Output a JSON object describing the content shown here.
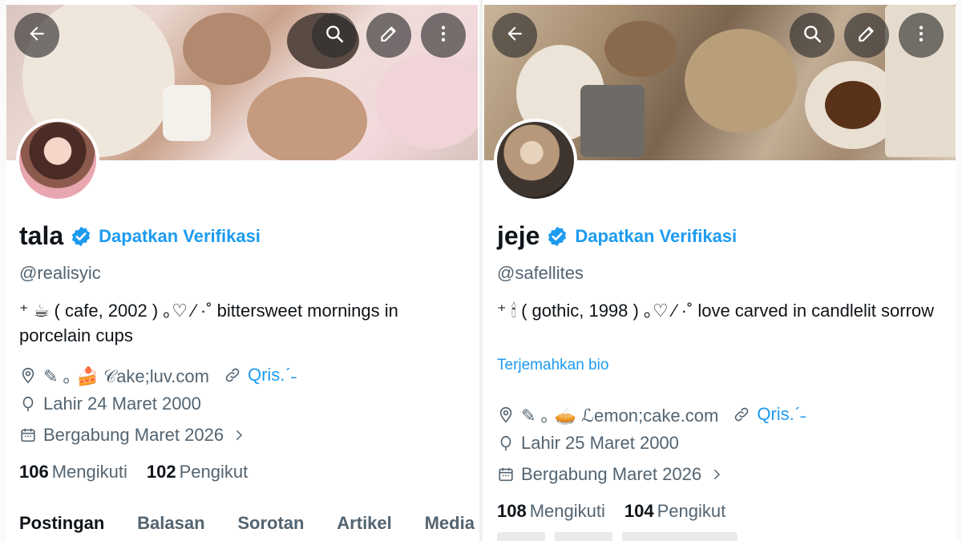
{
  "colors": {
    "accent": "#1d9bf0",
    "text_primary": "#0f1419",
    "text_secondary": "#536471"
  },
  "left": {
    "name": "tala",
    "verify_label": "Dapatkan Verifikasi",
    "handle": "@realisyic",
    "bio": "⁺ ☕ ( cafe, 2002 ) ｡♡ ⁄ ·˚ bittersweet mornings in porcelain cups",
    "location": "✎ ｡ 🍰 𝒞ake;luv.com",
    "link": "Qris.ˊ˗",
    "birthday": "Lahir 24 Maret 2000",
    "joined": "Bergabung Maret 2026",
    "following_count": "106",
    "following_label": "Mengikuti",
    "followers_count": "102",
    "followers_label": "Pengikut",
    "tabs": [
      "Postingan",
      "Balasan",
      "Sorotan",
      "Artikel",
      "Media"
    ]
  },
  "right": {
    "name": "jeje",
    "verify_label": "Dapatkan Verifikasi",
    "handle": "@safellites",
    "bio": "⁺ 🕯 ( gothic, 1998 ) ｡♡ ⁄ ·˚ love carved in candlelit sorrow",
    "translate_label": "Terjemahkan bio",
    "location": "✎ ｡ 🥧 ℒemon;cake.com",
    "link": "Qris.ˊ˗",
    "birthday": "Lahir 25 Maret 2000",
    "joined": "Bergabung Maret 2026",
    "following_count": "108",
    "following_label": "Mengikuti",
    "followers_count": "104",
    "followers_label": "Pengikut"
  },
  "icons": [
    "back-arrow-icon",
    "search-icon",
    "edit-icon",
    "more-icon",
    "verified-badge-icon",
    "location-icon",
    "link-icon",
    "birthday-icon",
    "calendar-icon",
    "chevron-right-icon"
  ]
}
